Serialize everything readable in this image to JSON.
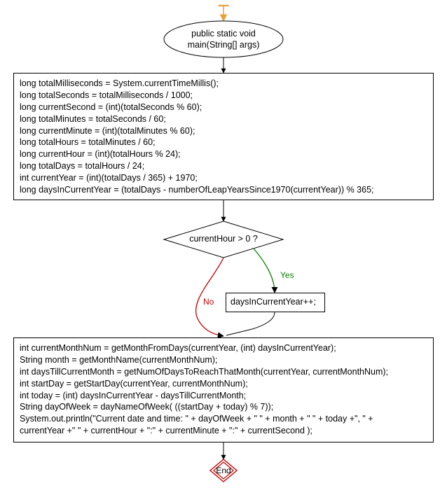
{
  "start": {
    "line1": "public static void",
    "line2": "main(String[] args)"
  },
  "block1": "long totalMilliseconds = System.currentTimeMillis();\nlong totalSeconds = totalMilliseconds / 1000;\nlong currentSecond = (int)(totalSeconds % 60);\nlong totalMinutes = totalSeconds / 60;\nlong currentMinute = (int)(totalMinutes % 60);\nlong totalHours = totalMinutes / 60;\nlong currentHour = (int)(totalHours % 24);\nlong totalDays = totalHours / 24;\nint currentYear = (int)(totalDays / 365) + 1970;\nlong daysInCurrentYear = (totalDays - numberOfLeapYearsSince1970(currentYear)) % 365;",
  "decision": "currentHour > 0 ?",
  "yesLabel": "Yes",
  "noLabel": "No",
  "incBlock": "daysInCurrentYear++;",
  "block2": "int currentMonthNum = getMonthFromDays(currentYear, (int) daysInCurrentYear);\nString month = getMonthName(currentMonthNum);\nint daysTillCurrentMonth = getNumOfDaysToReachThatMonth(currentYear, currentMonthNum);\nint startDay = getStartDay(currentYear, currentMonthNum);\nint today = (int) daysInCurrentYear - daysTillCurrentMonth;\nString dayOfWeek = dayNameOfWeek( ((startDay + today) % 7));\nSystem.out.println(\"Current date and time: \" + dayOfWeek + \" \" + month + \" \" + today +\", \" +\ncurrentYear +\" \" + currentHour + \":\" + currentMinute + \":\" + currentSecond );",
  "end": "End"
}
